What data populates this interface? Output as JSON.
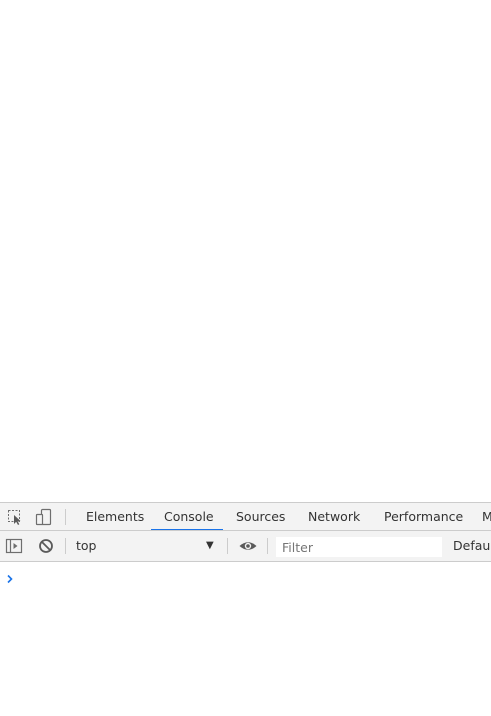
{
  "devtools": {
    "tabs": [
      {
        "label": "Elements",
        "active": false
      },
      {
        "label": "Console",
        "active": true
      },
      {
        "label": "Sources",
        "active": false
      },
      {
        "label": "Network",
        "active": false
      },
      {
        "label": "Performance",
        "active": false
      },
      {
        "label": "M",
        "active": false
      }
    ],
    "accent_color": "#1a73e8",
    "icons": [
      "inspect-element-icon",
      "device-toolbar-icon"
    ]
  },
  "console_toolbar": {
    "context_value": "top",
    "filter_placeholder": "Filter",
    "levels_label": "Defaul",
    "icons": [
      "sidebar-toggle-icon",
      "clear-console-icon",
      "dropdown-arrow-icon",
      "eye-icon"
    ]
  },
  "console": {
    "prompt_icon": "chevron-right-icon",
    "input_value": ""
  }
}
